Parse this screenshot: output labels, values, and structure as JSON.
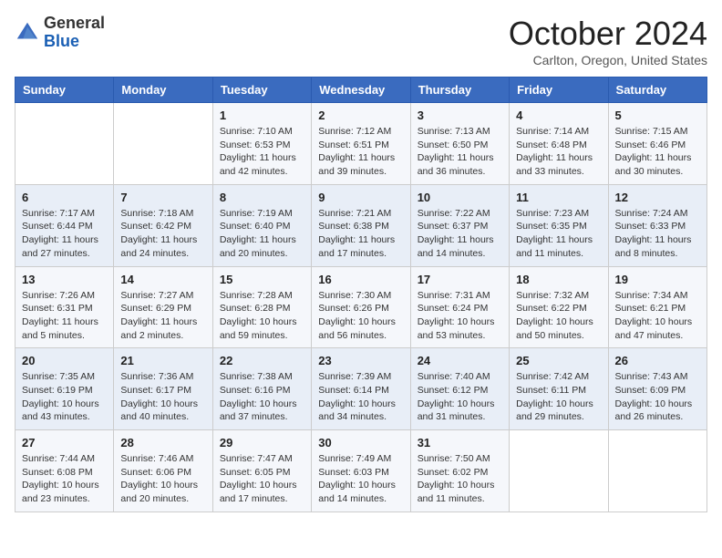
{
  "header": {
    "logo_general": "General",
    "logo_blue": "Blue",
    "month_title": "October 2024",
    "location": "Carlton, Oregon, United States"
  },
  "days_of_week": [
    "Sunday",
    "Monday",
    "Tuesday",
    "Wednesday",
    "Thursday",
    "Friday",
    "Saturday"
  ],
  "weeks": [
    [
      {
        "day": "",
        "detail": ""
      },
      {
        "day": "",
        "detail": ""
      },
      {
        "day": "1",
        "detail": "Sunrise: 7:10 AM\nSunset: 6:53 PM\nDaylight: 11 hours and 42 minutes."
      },
      {
        "day": "2",
        "detail": "Sunrise: 7:12 AM\nSunset: 6:51 PM\nDaylight: 11 hours and 39 minutes."
      },
      {
        "day": "3",
        "detail": "Sunrise: 7:13 AM\nSunset: 6:50 PM\nDaylight: 11 hours and 36 minutes."
      },
      {
        "day": "4",
        "detail": "Sunrise: 7:14 AM\nSunset: 6:48 PM\nDaylight: 11 hours and 33 minutes."
      },
      {
        "day": "5",
        "detail": "Sunrise: 7:15 AM\nSunset: 6:46 PM\nDaylight: 11 hours and 30 minutes."
      }
    ],
    [
      {
        "day": "6",
        "detail": "Sunrise: 7:17 AM\nSunset: 6:44 PM\nDaylight: 11 hours and 27 minutes."
      },
      {
        "day": "7",
        "detail": "Sunrise: 7:18 AM\nSunset: 6:42 PM\nDaylight: 11 hours and 24 minutes."
      },
      {
        "day": "8",
        "detail": "Sunrise: 7:19 AM\nSunset: 6:40 PM\nDaylight: 11 hours and 20 minutes."
      },
      {
        "day": "9",
        "detail": "Sunrise: 7:21 AM\nSunset: 6:38 PM\nDaylight: 11 hours and 17 minutes."
      },
      {
        "day": "10",
        "detail": "Sunrise: 7:22 AM\nSunset: 6:37 PM\nDaylight: 11 hours and 14 minutes."
      },
      {
        "day": "11",
        "detail": "Sunrise: 7:23 AM\nSunset: 6:35 PM\nDaylight: 11 hours and 11 minutes."
      },
      {
        "day": "12",
        "detail": "Sunrise: 7:24 AM\nSunset: 6:33 PM\nDaylight: 11 hours and 8 minutes."
      }
    ],
    [
      {
        "day": "13",
        "detail": "Sunrise: 7:26 AM\nSunset: 6:31 PM\nDaylight: 11 hours and 5 minutes."
      },
      {
        "day": "14",
        "detail": "Sunrise: 7:27 AM\nSunset: 6:29 PM\nDaylight: 11 hours and 2 minutes."
      },
      {
        "day": "15",
        "detail": "Sunrise: 7:28 AM\nSunset: 6:28 PM\nDaylight: 10 hours and 59 minutes."
      },
      {
        "day": "16",
        "detail": "Sunrise: 7:30 AM\nSunset: 6:26 PM\nDaylight: 10 hours and 56 minutes."
      },
      {
        "day": "17",
        "detail": "Sunrise: 7:31 AM\nSunset: 6:24 PM\nDaylight: 10 hours and 53 minutes."
      },
      {
        "day": "18",
        "detail": "Sunrise: 7:32 AM\nSunset: 6:22 PM\nDaylight: 10 hours and 50 minutes."
      },
      {
        "day": "19",
        "detail": "Sunrise: 7:34 AM\nSunset: 6:21 PM\nDaylight: 10 hours and 47 minutes."
      }
    ],
    [
      {
        "day": "20",
        "detail": "Sunrise: 7:35 AM\nSunset: 6:19 PM\nDaylight: 10 hours and 43 minutes."
      },
      {
        "day": "21",
        "detail": "Sunrise: 7:36 AM\nSunset: 6:17 PM\nDaylight: 10 hours and 40 minutes."
      },
      {
        "day": "22",
        "detail": "Sunrise: 7:38 AM\nSunset: 6:16 PM\nDaylight: 10 hours and 37 minutes."
      },
      {
        "day": "23",
        "detail": "Sunrise: 7:39 AM\nSunset: 6:14 PM\nDaylight: 10 hours and 34 minutes."
      },
      {
        "day": "24",
        "detail": "Sunrise: 7:40 AM\nSunset: 6:12 PM\nDaylight: 10 hours and 31 minutes."
      },
      {
        "day": "25",
        "detail": "Sunrise: 7:42 AM\nSunset: 6:11 PM\nDaylight: 10 hours and 29 minutes."
      },
      {
        "day": "26",
        "detail": "Sunrise: 7:43 AM\nSunset: 6:09 PM\nDaylight: 10 hours and 26 minutes."
      }
    ],
    [
      {
        "day": "27",
        "detail": "Sunrise: 7:44 AM\nSunset: 6:08 PM\nDaylight: 10 hours and 23 minutes."
      },
      {
        "day": "28",
        "detail": "Sunrise: 7:46 AM\nSunset: 6:06 PM\nDaylight: 10 hours and 20 minutes."
      },
      {
        "day": "29",
        "detail": "Sunrise: 7:47 AM\nSunset: 6:05 PM\nDaylight: 10 hours and 17 minutes."
      },
      {
        "day": "30",
        "detail": "Sunrise: 7:49 AM\nSunset: 6:03 PM\nDaylight: 10 hours and 14 minutes."
      },
      {
        "day": "31",
        "detail": "Sunrise: 7:50 AM\nSunset: 6:02 PM\nDaylight: 10 hours and 11 minutes."
      },
      {
        "day": "",
        "detail": ""
      },
      {
        "day": "",
        "detail": ""
      }
    ]
  ]
}
